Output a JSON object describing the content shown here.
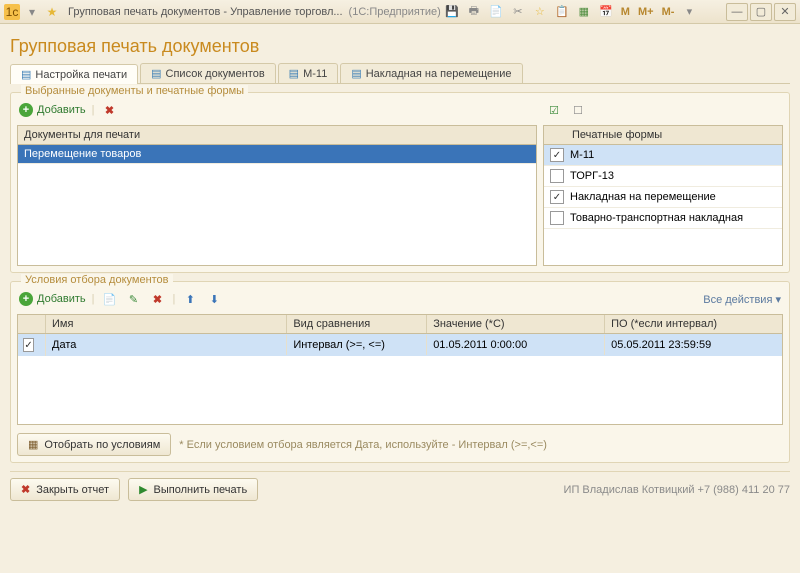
{
  "window": {
    "title": "Групповая печать документов - Управление торговл...",
    "subtitle": "(1С:Предприятие)"
  },
  "page": {
    "title": "Групповая печать документов"
  },
  "tabs": [
    {
      "label": "Настройка печати"
    },
    {
      "label": "Список документов"
    },
    {
      "label": "М-11"
    },
    {
      "label": "Накладная на перемещение"
    }
  ],
  "group1": {
    "title": "Выбранные документы и печатные формы",
    "add_label": "Добавить",
    "left_header": "Документы для печати",
    "left_row": "Перемещение товаров",
    "right_header": "Печатные формы",
    "forms": [
      {
        "checked": true,
        "label": "М-11"
      },
      {
        "checked": false,
        "label": "ТОРГ-13"
      },
      {
        "checked": true,
        "label": "Накладная на перемещение"
      },
      {
        "checked": false,
        "label": "Товарно-транспортная накладная"
      }
    ]
  },
  "group2": {
    "title": "Условия отбора документов",
    "add_label": "Добавить",
    "all_actions": "Все действия ▾",
    "headers": {
      "name": "Имя",
      "cmp": "Вид сравнения",
      "val": "Значение (*С)",
      "to": "ПО (*если интервал)"
    },
    "row": {
      "name": "Дата",
      "cmp": "Интервал (>=, <=)",
      "val": "01.05.2011 0:00:00",
      "to": "05.05.2011 23:59:59"
    }
  },
  "filter_btn": "Отобрать по условиям",
  "filter_hint": "* Если условием отбора является Дата, используйте - Интервал (>=,<=)",
  "footer": {
    "close": "Закрыть отчет",
    "print": "Выполнить печать",
    "info": "ИП Владислав Котвицкий +7 (988) 411 20 77"
  },
  "mem": {
    "m": "M",
    "mplus": "M+",
    "mminus": "M-"
  }
}
